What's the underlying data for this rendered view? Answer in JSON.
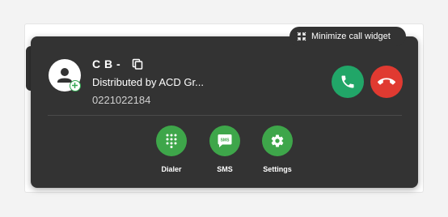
{
  "widget": {
    "minimize_label": "Minimize call widget",
    "contact": {
      "name": "C B -",
      "company": "Distributed by ACD Gr...",
      "number": "0221022184"
    },
    "actions": [
      {
        "label": "Dialer",
        "icon": "dialpad-icon"
      },
      {
        "label": "SMS",
        "icon": "sms-icon"
      },
      {
        "label": "Settings",
        "icon": "gear-icon"
      }
    ],
    "sms_icon_text": "SMS",
    "colors": {
      "widget_bg": "#333333",
      "answer": "#21a668",
      "hangup": "#e03a31",
      "action": "#3ea64a"
    }
  }
}
